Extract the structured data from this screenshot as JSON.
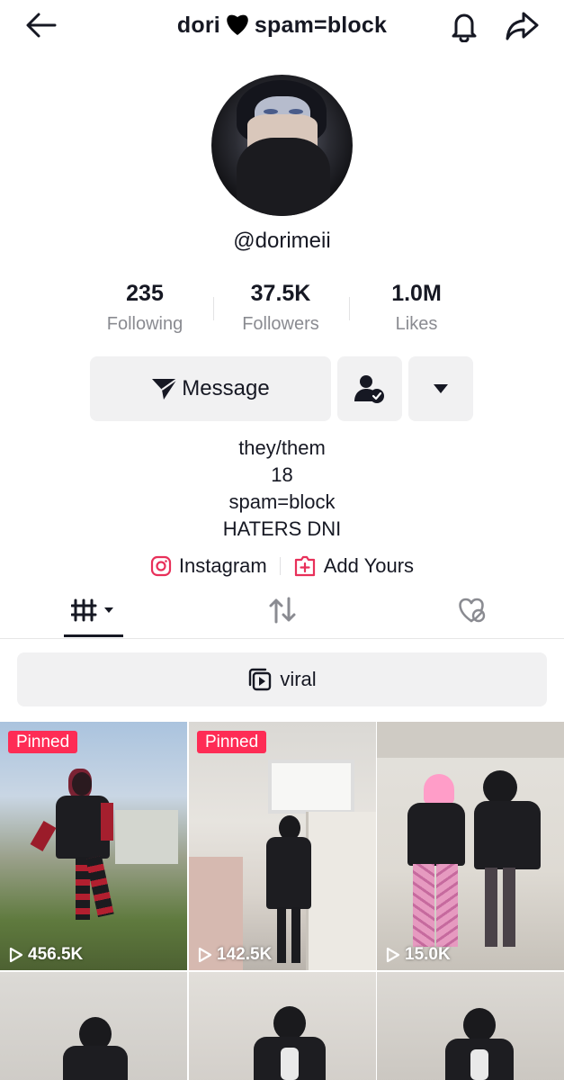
{
  "header": {
    "title_left": "dori",
    "title_right": "spam=block"
  },
  "profile": {
    "handle": "@dorimeii",
    "stats": [
      {
        "value": "235",
        "label": "Following"
      },
      {
        "value": "37.5K",
        "label": "Followers"
      },
      {
        "value": "1.0M",
        "label": "Likes"
      }
    ]
  },
  "actions": {
    "message_label": "Message"
  },
  "bio": {
    "lines": [
      "they/them",
      "18",
      "spam=block",
      "HATERS DNI"
    ]
  },
  "links": {
    "instagram": "Instagram",
    "add_yours": "Add Yours"
  },
  "playlist": {
    "label": "viral"
  },
  "videos": [
    {
      "views": "456.5K",
      "pinned": "Pinned"
    },
    {
      "views": "142.5K",
      "pinned": "Pinned"
    },
    {
      "views": "15.0K"
    },
    {},
    {},
    {}
  ],
  "colors": {
    "accent": "#fe2c55",
    "button_bg": "#f1f1f2",
    "text": "#161823",
    "muted": "#8a8b91"
  }
}
